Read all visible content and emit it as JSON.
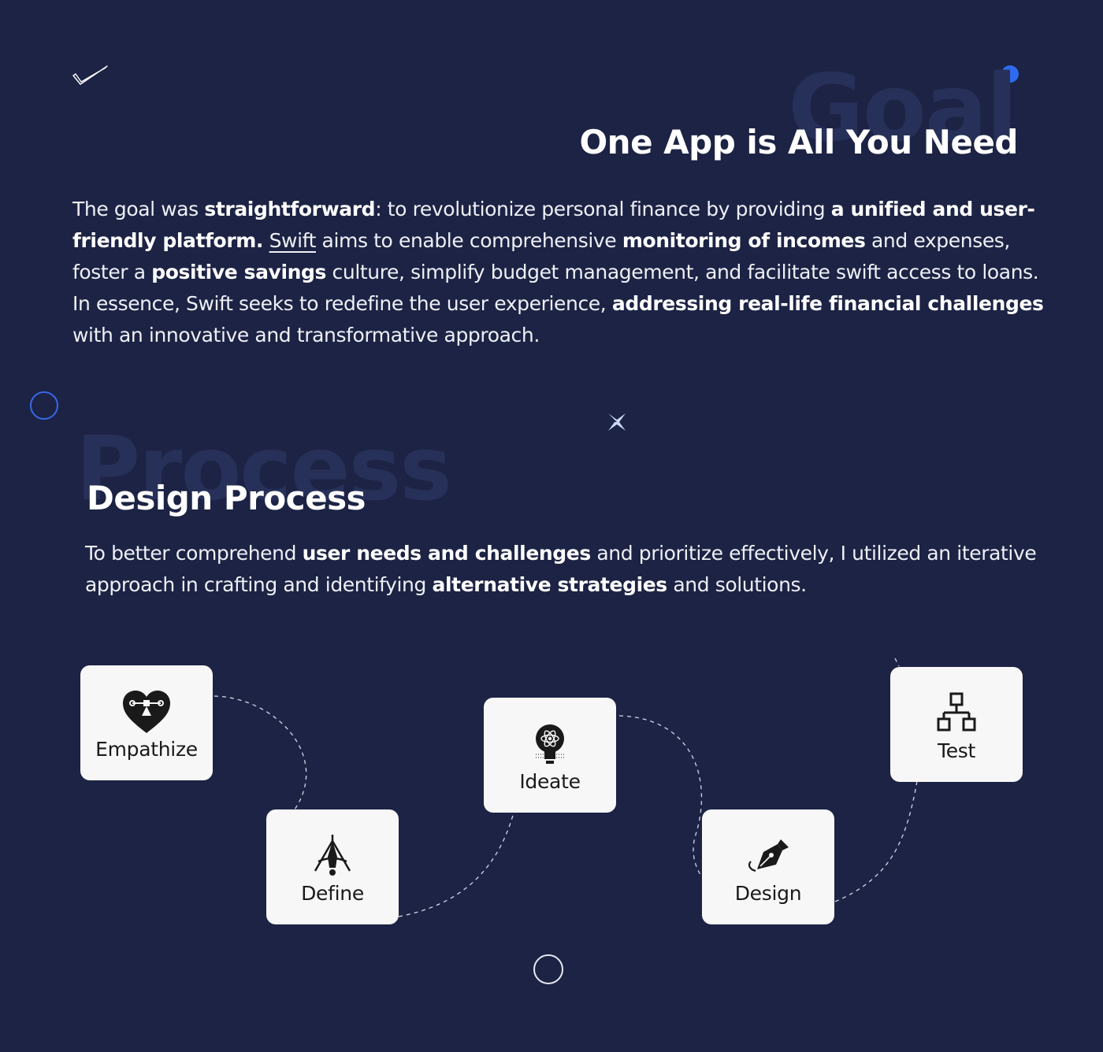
{
  "goal": {
    "watermark": "Goal",
    "title": "One App is All You Need",
    "paragraph": [
      {
        "t": "The goal was "
      },
      {
        "t": "straightforward",
        "b": true
      },
      {
        "t": ": to revolutionize personal finance by providing "
      },
      {
        "t": "a unified and user-friendly platform.",
        "b": true
      },
      {
        "t": " "
      },
      {
        "t": "Swift",
        "u": true
      },
      {
        "t": " aims to enable comprehensive "
      },
      {
        "t": "monitoring of incomes",
        "b": true
      },
      {
        "t": " and expenses, foster a "
      },
      {
        "t": "positive savings",
        "b": true
      },
      {
        "t": " culture, simplify budget management, and facilitate swift access to loans. In essence, Swift seeks to redefine the user experience, "
      },
      {
        "t": "addressing real-life financial challenges",
        "b": true
      },
      {
        "t": " with an innovative and transformative approach."
      }
    ]
  },
  "process": {
    "watermark": "Process",
    "title": "Design Process",
    "paragraph": [
      {
        "t": "To better comprehend "
      },
      {
        "t": "user needs and challenges",
        "b": true
      },
      {
        "t": " and prioritize effectively, I utilized an iterative approach in crafting and identifying "
      },
      {
        "t": "alternative strategies",
        "b": true
      },
      {
        "t": " and solutions."
      }
    ],
    "steps": [
      {
        "label": "Empathize",
        "icon": "heart-icon"
      },
      {
        "label": "Define",
        "icon": "compass-icon"
      },
      {
        "label": "Ideate",
        "icon": "lightbulb-icon"
      },
      {
        "label": "Design",
        "icon": "pen-nib-icon"
      },
      {
        "label": "Test",
        "icon": "hierarchy-icon"
      }
    ]
  },
  "colors": {
    "background": "#1c2344",
    "accent_blue": "#2f6bf0",
    "card": "#f7f7f7",
    "watermark": "#273058"
  }
}
